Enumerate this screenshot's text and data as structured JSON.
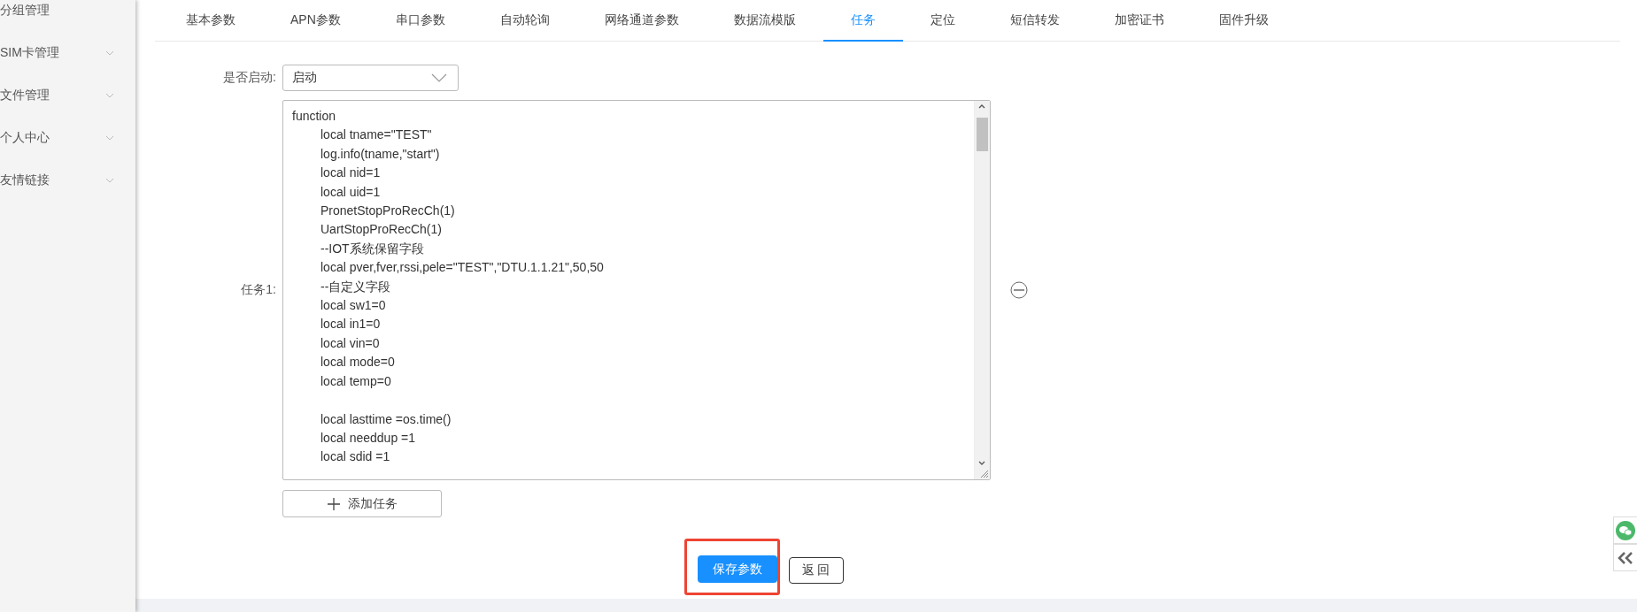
{
  "sidebar": {
    "items": [
      {
        "label": "分组管理",
        "chevron": false
      },
      {
        "label": "SIM卡管理",
        "chevron": true
      },
      {
        "label": "文件管理",
        "chevron": true
      },
      {
        "label": "个人中心",
        "chevron": true
      },
      {
        "label": "友情链接",
        "chevron": true
      }
    ]
  },
  "tabs": [
    {
      "label": "基本参数",
      "selected": false
    },
    {
      "label": "APN参数",
      "selected": false
    },
    {
      "label": "串口参数",
      "selected": false
    },
    {
      "label": "自动轮询",
      "selected": false
    },
    {
      "label": "网络通道参数",
      "selected": false
    },
    {
      "label": "数据流模版",
      "selected": false
    },
    {
      "label": "任务",
      "selected": true
    },
    {
      "label": "定位",
      "selected": false
    },
    {
      "label": "短信转发",
      "selected": false
    },
    {
      "label": "加密证书",
      "selected": false
    },
    {
      "label": "固件升级",
      "selected": false
    }
  ],
  "enable": {
    "label": "是否启动:",
    "value": "启动"
  },
  "tasks": [
    {
      "label": "任务1:",
      "code": "function\n\tlocal tname=\"TEST\"\n\tlog.info(tname,\"start\")\n\tlocal nid=1\n\tlocal uid=1\n\tPronetStopProRecCh(1)\n\tUartStopProRecCh(1)\n\t--IOT系统保留字段\n\tlocal pver,fver,rssi,pele=\"TEST\",\"DTU.1.1.21\",50,50\n\t--自定义字段\n\tlocal sw1=0\n\tlocal in1=0\n\tlocal vin=0\n\tlocal mode=0\n\tlocal temp=0\n\n\tlocal lasttime =os.time()\n\tlocal needdup =1\n\tlocal sdid =1"
    }
  ],
  "add_button": "添加任务",
  "actions": {
    "save": {
      "label": "保存参数",
      "highlighted": true
    },
    "back": {
      "label": "返 回"
    }
  }
}
